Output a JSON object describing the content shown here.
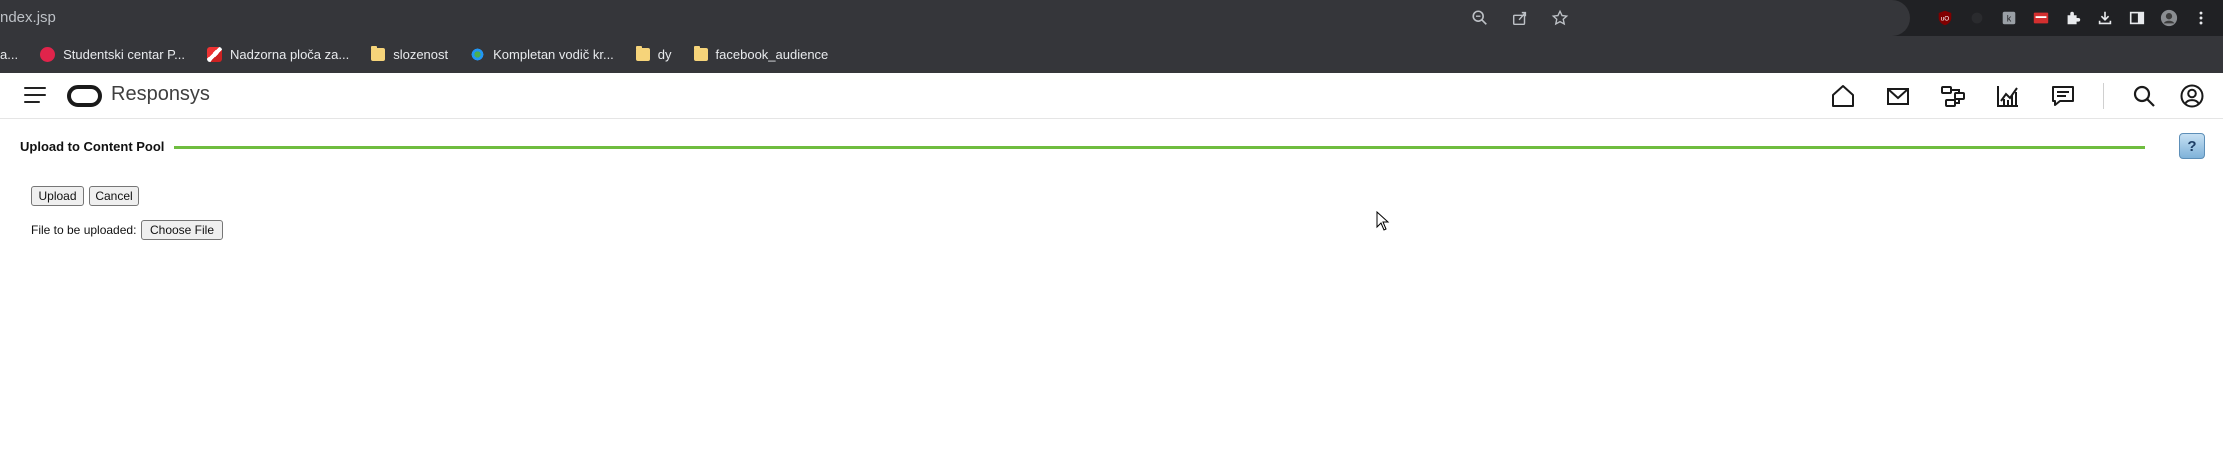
{
  "browser": {
    "url": "ndex.jsp",
    "omnibox_icons": [
      "zoom-icon",
      "share-icon",
      "star-icon"
    ],
    "extension_icons": [
      "ublock-icon",
      "extension-icon",
      "extension-icon",
      "extension-icon",
      "puzzle-icon",
      "download-icon",
      "side-panel-icon",
      "profile-icon",
      "menu-icon"
    ]
  },
  "bookmarks": [
    {
      "label": "a...",
      "icon": "none"
    },
    {
      "label": "Studentski centar P...",
      "icon": "red-circle-icon"
    },
    {
      "label": "Nadzorna ploča za...",
      "icon": "image-icon"
    },
    {
      "label": "slozenost",
      "icon": "folder-icon"
    },
    {
      "label": "Kompletan vodič kr...",
      "icon": "colorful-icon"
    },
    {
      "label": "dy",
      "icon": "folder-icon"
    },
    {
      "label": "facebook_audience",
      "icon": "folder-icon"
    }
  ],
  "app": {
    "brand": "Responsys",
    "nav_icons": [
      "home-icon",
      "mail-icon",
      "program-icon",
      "insight-icon",
      "chat-icon",
      "search-icon",
      "user-icon"
    ]
  },
  "page": {
    "title": "Upload to Content Pool",
    "upload_label": "Upload",
    "cancel_label": "Cancel",
    "file_label": "File to be uploaded:",
    "choose_label": "Choose File",
    "help_label": "?"
  },
  "colors": {
    "rule": "#6fbd3f",
    "chrome_dark": "#202124",
    "chrome_bar": "#35363a"
  }
}
